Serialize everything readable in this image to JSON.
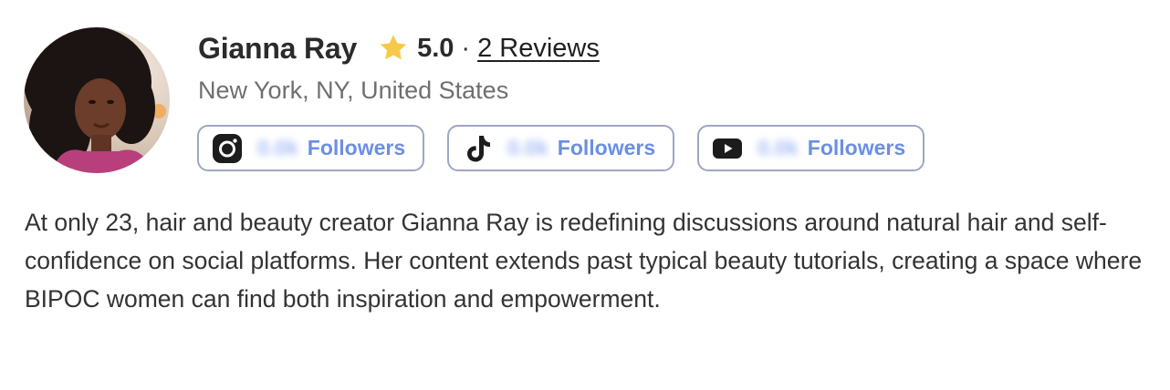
{
  "profile": {
    "name": "Gianna Ray",
    "rating": "5.0",
    "separator": "·",
    "reviews_label": "2 Reviews",
    "location": "New York, NY, United States",
    "bio": "At only 23, hair and beauty creator Gianna Ray is redefining discussions around natural hair and self-confidence on social platforms. Her content extends past typical beauty tutorials, creating a space where BIPOC women can find both inspiration and empowerment."
  },
  "socials": [
    {
      "platform": "instagram",
      "icon": "instagram-icon",
      "count": "0.0k",
      "label": "Followers"
    },
    {
      "platform": "tiktok",
      "icon": "tiktok-icon",
      "count": "0.0k",
      "label": "Followers"
    },
    {
      "platform": "youtube",
      "icon": "youtube-icon",
      "count": "0.0k",
      "label": "Followers"
    }
  ],
  "colors": {
    "star": "#f7c948",
    "follower_text": "#6b8fe3",
    "pill_border": "#9ea6c4",
    "name_text": "#2b2b2b",
    "location_text": "#6f6f6f"
  }
}
